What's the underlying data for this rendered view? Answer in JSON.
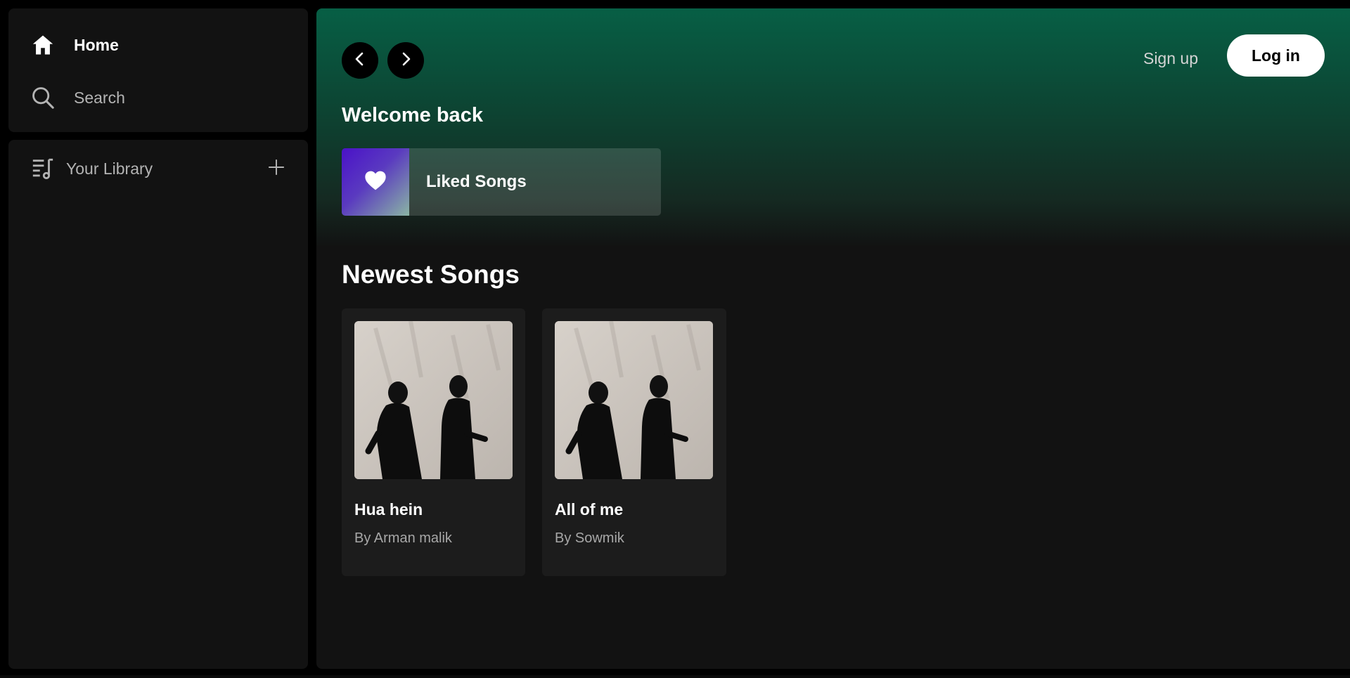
{
  "sidebar": {
    "nav": {
      "home_label": "Home",
      "search_label": "Search"
    },
    "library": {
      "title": "Your Library"
    }
  },
  "header": {
    "signup_label": "Sign up",
    "login_label": "Log in"
  },
  "main": {
    "welcome_title": "Welcome back",
    "liked_songs_label": "Liked Songs",
    "newest_title": "Newest Songs",
    "songs": [
      {
        "title": "Hua hein",
        "artist": "By Arman malik"
      },
      {
        "title": "All of me",
        "artist": "By Sowmik"
      }
    ]
  },
  "colors": {
    "accent_green": "#075f45",
    "panel_bg": "#121212",
    "card_bg": "#1c1c1c"
  },
  "icons": [
    "home-icon",
    "search-icon",
    "library-icon",
    "plus-icon",
    "chevron-left-icon",
    "chevron-right-icon",
    "heart-icon"
  ]
}
